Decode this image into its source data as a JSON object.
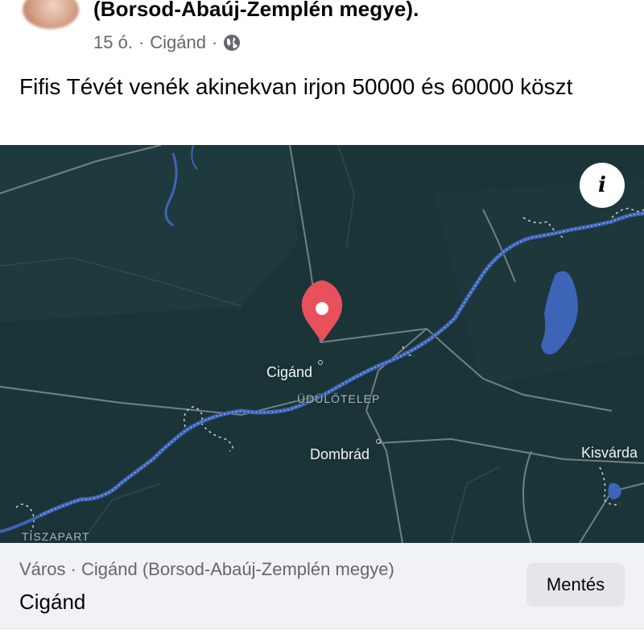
{
  "post": {
    "group_name": "(Borsod-Abaúj-Zemplén megye).",
    "time": "15 ó.",
    "separator": "·",
    "location": "Cigánd",
    "privacy_icon": "globe-icon",
    "text": "Fifis Tévét venék akinekvan irjon 50000 és 60000 köszt"
  },
  "map": {
    "info_icon_label": "i",
    "labels": {
      "cigand": "Cigánd",
      "udulotelep": "ÜDÜLŐTELEP",
      "dombrad": "Dombrád",
      "kisvarda": "Kisvárda",
      "tiszapart": "TISZAPART"
    },
    "colors": {
      "background": "#1b3438",
      "road": "#6f8285",
      "river": "#3e64b8",
      "lake": "#3e64b8",
      "pin": "#e8505b"
    }
  },
  "place_card": {
    "subtitle": "Város · Cigánd (Borsod-Abaúj-Zemplén megye)",
    "name": "Cigánd",
    "save_label": "Mentés"
  }
}
